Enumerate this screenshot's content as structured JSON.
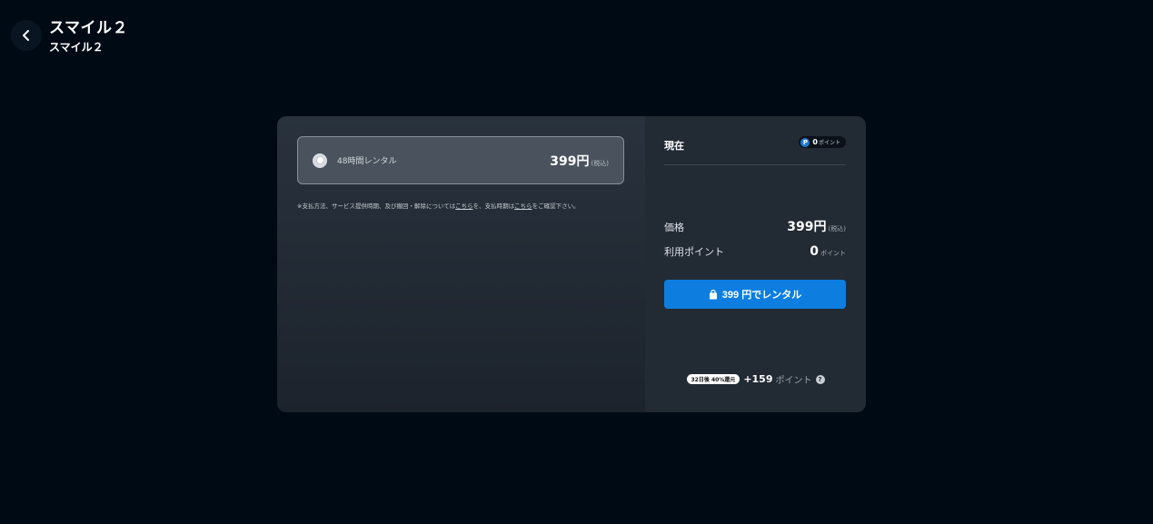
{
  "header": {
    "title": "スマイル２",
    "subtitle": "スマイル２"
  },
  "plan": {
    "option_label": "48時間レンタル",
    "price": "399円",
    "tax_note": "(税込)",
    "notice_prefix": "※支払方法、サービス提供時期、及び撤回・解除については",
    "notice_link1": "こちら",
    "notice_middle": "を、支払時期は",
    "notice_link2": "こちら",
    "notice_suffix": "をご確認下さい。"
  },
  "summary": {
    "current_label": "現在",
    "points_icon": "P",
    "points_balance": "0",
    "points_unit": "ポイント",
    "price_label": "価格",
    "price_value": "399円",
    "price_tax": "(税込)",
    "use_points_label": "利用ポイント",
    "use_points_value": "0",
    "use_points_unit": "ポイント",
    "rent_button_label": "399 円でレンタル",
    "reward_badge": "32日後 40%還元",
    "reward_points": "+159",
    "reward_unit": "ポイント",
    "help_icon": "?"
  },
  "colors": {
    "background": "#000a14",
    "accent": "#0d7ee0",
    "points_icon": "#1e7ad9"
  },
  "icons": {
    "back": "chevron-left-icon",
    "bag": "shopping-bag-icon",
    "help": "question-circle-icon",
    "points": "points-icon"
  }
}
